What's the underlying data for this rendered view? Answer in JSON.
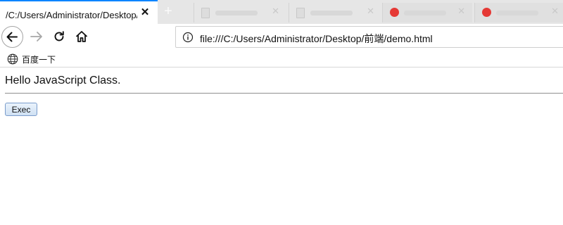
{
  "browser": {
    "active_tab": {
      "title": "/C:/Users/Administrator/Desktop/前端/demo.html",
      "close_glyph": "✕"
    },
    "new_tab_glyph": "+",
    "background_tabs": [
      {
        "favicon": "document-icon",
        "favicon_color": "#dddddd"
      },
      {
        "favicon": "document-icon",
        "favicon_color": "#dddddd"
      },
      {
        "favicon": "red-logo-icon",
        "favicon_color": "#e53935"
      },
      {
        "favicon": "red-logo-icon",
        "favicon_color": "#e53935"
      }
    ],
    "address": {
      "url": "file:///C:/Users/Administrator/Desktop/前端/demo.html",
      "icon": "info-icon"
    },
    "bookmarks": [
      {
        "label": "百度一下",
        "icon": "globe-icon"
      }
    ]
  },
  "page": {
    "text": "Hello JavaScript Class.",
    "exec_button_label": "Exec"
  },
  "colors": {
    "active_tab_accent": "#0a84ff",
    "tabstrip_bg": "#e6e6e6"
  }
}
